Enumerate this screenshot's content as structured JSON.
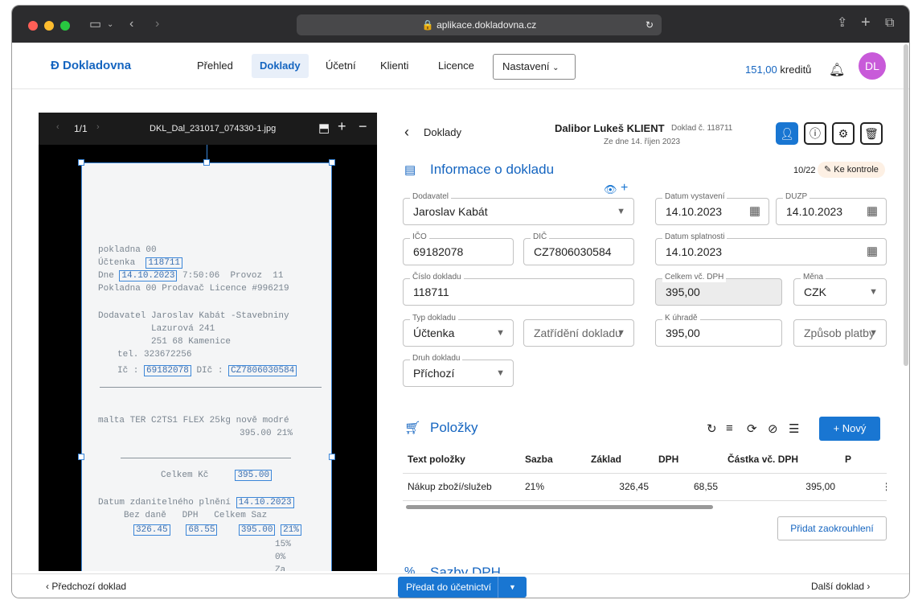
{
  "browser": {
    "url": "aplikace.dokladovna.cz"
  },
  "nav": {
    "logo": "Dokladovna",
    "items": [
      "Přehled",
      "Doklady",
      "Účetní",
      "Klienti",
      "Licence"
    ],
    "active": "Doklady",
    "settings": "Nastavení",
    "credits_value": "151,00",
    "credits_label": "kreditů",
    "avatar": "DL"
  },
  "preview": {
    "page": "1/1",
    "filename": "DKL_Dal_231017_074330-1.jpg"
  },
  "receipt": {
    "lines": {
      "l1": "pokladna 00",
      "l2a": "Účtenka",
      "l2b": "118711",
      "l3a": "Dne",
      "l3b": "14.10.2023",
      "l3c": "7:50:06  Provoz  11",
      "l4": "Pokladna 00 Prodavač Licence #996219",
      "l5": "Dodavatel Jaroslav Kabát -Stavebniny",
      "l6": "Lazurová 241",
      "l7": "251 68 Kamenice",
      "l8": "tel. 323672256",
      "l9a": "Ič :",
      "l9b": "69182078",
      "l9c": "DIč :",
      "l9d": "CZ7806030584",
      "l10": "malta TER C2TS1 FLEX 25kg nově modré",
      "l11": "395.00 21%",
      "l12a": "Celkem Kč",
      "l12b": "395.00",
      "l13a": "Datum zdanitelného plnění",
      "l13b": "14.10.2023",
      "l14a": "Bez daně",
      "l14b": "DPH",
      "l14c": "Celkem Saz",
      "l15a": "326.45",
      "l15b": "68.55",
      "l15c": "395.00",
      "l15d": "21%",
      "l16": "15%",
      "l17": "0%",
      "l18": "Za"
    }
  },
  "header": {
    "back": "Doklady",
    "client": "Dalibor Lukeš KLIENT",
    "doc_no": "Doklad č. 118711",
    "date": "Ze dne 14. říjen 2023"
  },
  "section_info": {
    "title": "Informace o dokladu",
    "counter": "10/22",
    "status": "Ke kontrole"
  },
  "fields": {
    "dodavatel": {
      "label": "Dodavatel",
      "value": "Jaroslav Kabát"
    },
    "datum_vystaveni": {
      "label": "Datum vystavení",
      "value": "14.10.2023"
    },
    "duzp": {
      "label": "DUZP",
      "value": "14.10.2023"
    },
    "ico": {
      "label": "IČO",
      "value": "69182078"
    },
    "dic": {
      "label": "DIČ",
      "value": "CZ7806030584"
    },
    "datum_splatnosti": {
      "label": "Datum splatnosti",
      "value": "14.10.2023"
    },
    "cislo": {
      "label": "Číslo dokladu",
      "value": "118711"
    },
    "celkem": {
      "label": "Celkem vč. DPH",
      "value": "395,00"
    },
    "mena": {
      "label": "Měna",
      "value": "CZK"
    },
    "typ": {
      "label": "Typ dokladu",
      "value": "Účtenka"
    },
    "zatrideni": {
      "placeholder": "Zatřídění dokladu"
    },
    "k_uhrade": {
      "label": "K úhradě",
      "value": "395,00"
    },
    "zpusob": {
      "placeholder": "Způsob platby"
    },
    "druh": {
      "label": "Druh dokladu",
      "value": "Příchozí"
    }
  },
  "items": {
    "title": "Položky",
    "new_button": "+ Nový",
    "columns": [
      "Text položky",
      "Sazba",
      "Základ",
      "DPH",
      "Částka vč. DPH",
      "P"
    ],
    "rows": [
      {
        "text": "Nákup zboží/služeb",
        "sazba": "21%",
        "zaklad": "326,45",
        "dph": "68,55",
        "castka": "395,00"
      }
    ],
    "add_rounding": "Přidat zaokrouhlení"
  },
  "section_vat": {
    "title": "Sazby DPH"
  },
  "footer": {
    "prev": "Předchozí doklad",
    "submit": "Předat do účetnictví",
    "next": "Další doklad"
  }
}
